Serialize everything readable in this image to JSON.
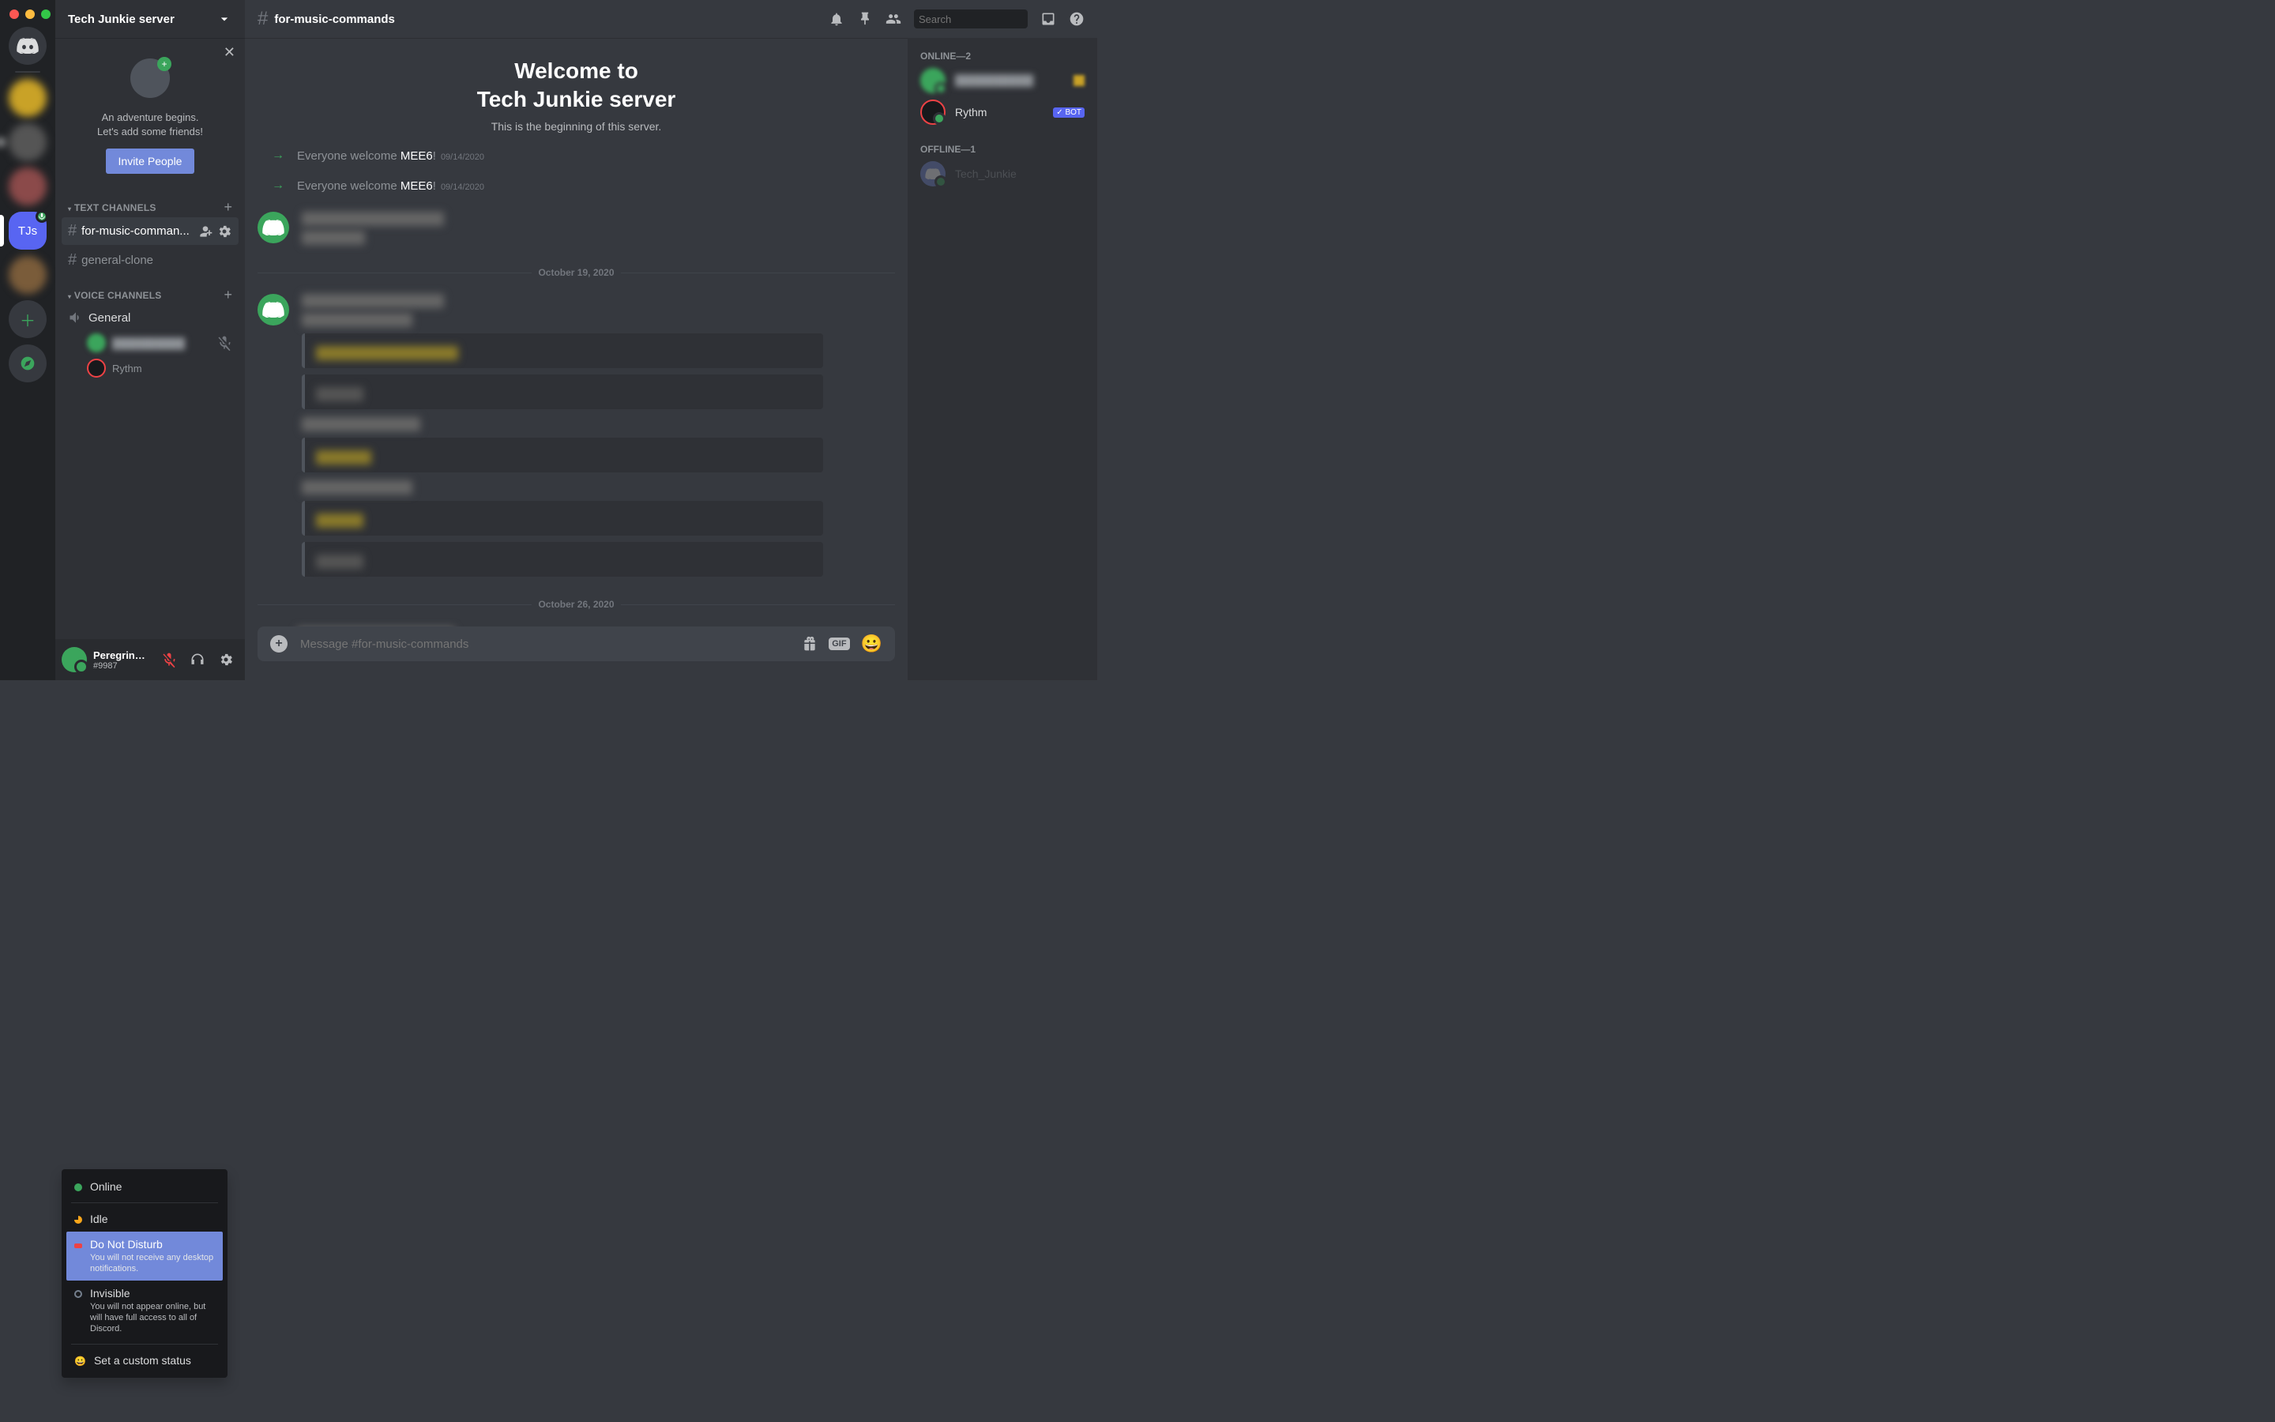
{
  "server": {
    "name": "Tech Junkie server"
  },
  "invite": {
    "line1": "An adventure begins.",
    "line2": "Let's add some friends!",
    "button": "Invite People"
  },
  "categories": {
    "text": {
      "label": "TEXT CHANNELS"
    },
    "voice": {
      "label": "VOICE CHANNELS"
    }
  },
  "channels": {
    "text": [
      {
        "name": "for-music-comman...",
        "fullname": "for-music-commands"
      },
      {
        "name": "general-clone"
      }
    ],
    "voice": [
      {
        "name": "General"
      }
    ],
    "voice_users": [
      {
        "name": "██████████"
      },
      {
        "name": "Rythm"
      }
    ]
  },
  "status_menu": {
    "online": "Online",
    "idle": "Idle",
    "dnd": "Do Not Disturb",
    "dnd_sub": "You will not receive any desktop notifications.",
    "invisible": "Invisible",
    "invisible_sub": "You will not appear online, but will have full access to all of Discord.",
    "custom": "Set a custom status"
  },
  "user_panel": {
    "name": "Peregrinepo...",
    "tag": "#9987"
  },
  "header": {
    "channel": "for-music-commands",
    "search_placeholder": "Search"
  },
  "welcome": {
    "line1": "Welcome to",
    "line2": "Tech Junkie server",
    "sub": "This is the beginning of this server."
  },
  "system_messages": [
    {
      "prefix": "Everyone welcome ",
      "user": "MEE6",
      "suffix": "!",
      "time": "09/14/2020"
    },
    {
      "prefix": "Everyone welcome ",
      "user": "MEE6",
      "suffix": "!",
      "time": "09/14/2020"
    }
  ],
  "dividers": {
    "d1": "October 19, 2020",
    "d2": "October 26, 2020"
  },
  "compose": {
    "placeholder": "Message #for-music-commands",
    "gif": "GIF"
  },
  "members": {
    "online_label": "ONLINE—2",
    "offline_label": "OFFLINE—1",
    "online": [
      {
        "name": "██████████",
        "type": "user"
      },
      {
        "name": "Rythm",
        "type": "bot"
      }
    ],
    "offline": [
      {
        "name": "Tech_Junkie"
      }
    ],
    "bot_badge": "✓ BOT"
  },
  "guild_selected": "TJs"
}
